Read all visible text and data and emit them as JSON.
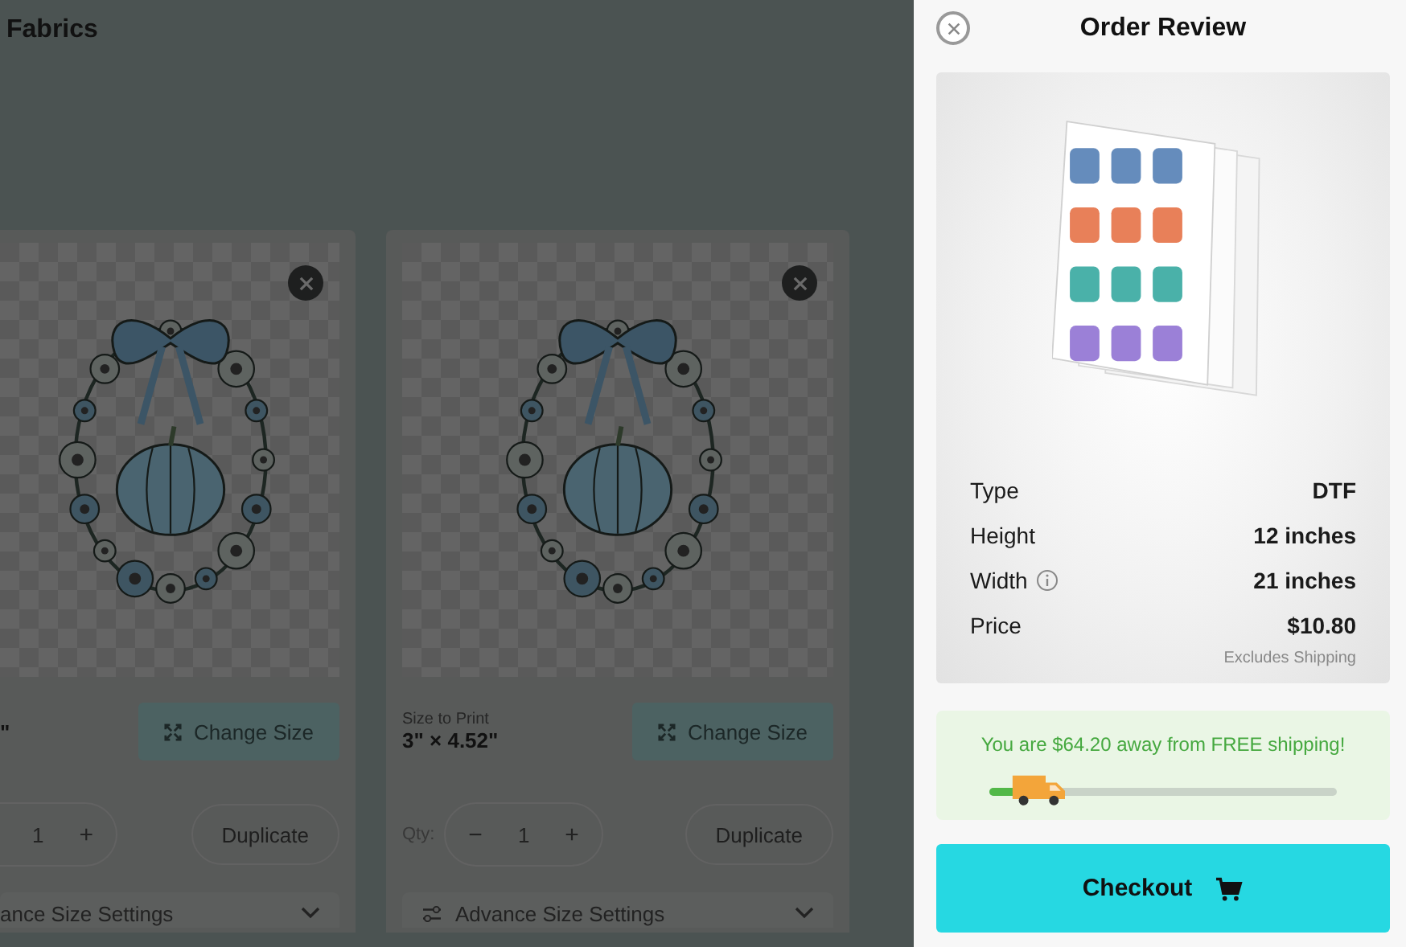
{
  "page_title": "Fabrics",
  "cards": [
    {
      "size_value": "\"",
      "change_size": "Change Size",
      "qty_value": "1",
      "qty_plus": "+",
      "duplicate": "Duplicate",
      "advanced": "ance Size Settings"
    },
    {
      "size_label": "Size to Print",
      "size_value": "3\" × 4.52\"",
      "change_size": "Change Size",
      "qty_label": "Qty:",
      "qty_minus": "−",
      "qty_value": "1",
      "qty_plus": "+",
      "duplicate": "Duplicate",
      "advanced": "Advance Size Settings"
    }
  ],
  "panel": {
    "title": "Order Review",
    "specs": [
      {
        "label": "Type",
        "value": "DTF",
        "info": false
      },
      {
        "label": "Height",
        "value": "12 inches",
        "info": false
      },
      {
        "label": "Width",
        "value": "21 inches",
        "info": true
      },
      {
        "label": "Price",
        "value": "$10.80",
        "info": false
      }
    ],
    "price_note": "Excludes Shipping",
    "shipping": {
      "message": "You are $64.20 away from FREE shipping!",
      "level": 0.08
    },
    "checkout": "Checkout"
  }
}
